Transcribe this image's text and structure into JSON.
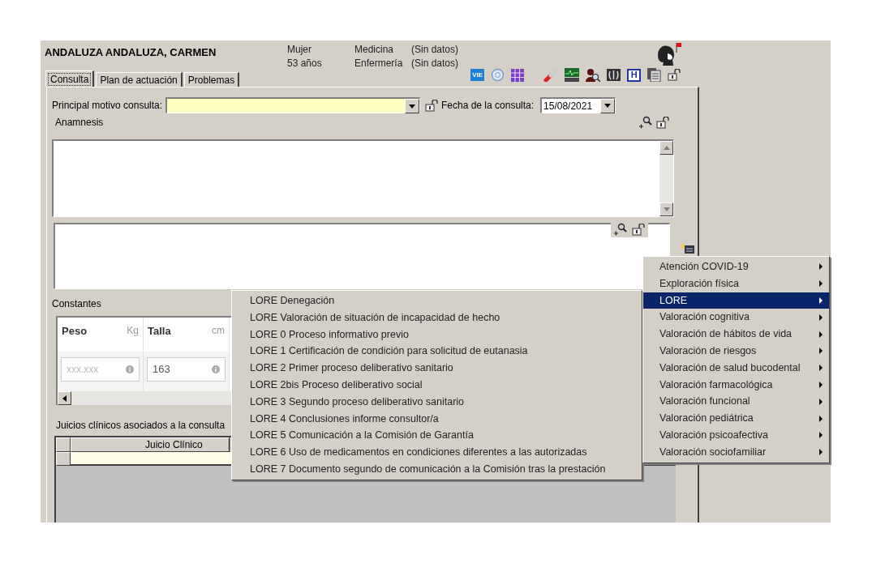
{
  "patient": {
    "name": "ANDALUZA ANDALUZA, CARMEN",
    "sex": "Mujer",
    "age": "53 años"
  },
  "services": [
    {
      "name": "Medicina",
      "value": "(Sin datos)"
    },
    {
      "name": "Enfermería",
      "value": "(Sin datos)"
    }
  ],
  "toolbar": [
    {
      "kind": "vie",
      "text": "VIE"
    },
    {
      "kind": "circle"
    },
    {
      "kind": "grid"
    },
    {
      "kind": "pill"
    },
    {
      "kind": "monitor"
    },
    {
      "kind": "person-search"
    },
    {
      "kind": "xray"
    },
    {
      "kind": "hospital",
      "text": "H"
    },
    {
      "kind": "documents"
    },
    {
      "kind": "lock"
    }
  ],
  "tabs": [
    {
      "label": "Consulta",
      "selected": true
    },
    {
      "label": "Plan de actuación",
      "selected": false
    },
    {
      "label": "Problemas",
      "selected": false
    }
  ],
  "motivo": {
    "label": "Principal motivo consulta:"
  },
  "fecha": {
    "label": "Fecha de la consulta:",
    "value": "15/08/2021"
  },
  "anamnesis": {
    "label": "Anamnesis"
  },
  "constantes": {
    "label": "Constantes",
    "items": [
      {
        "name": "Peso",
        "unit": "Kg",
        "placeholder": "xxx.xxx"
      },
      {
        "name": "Talla",
        "unit": "cm",
        "value": "163"
      }
    ]
  },
  "juicios": {
    "label": "Juicios clínicos asociados a la consulta",
    "column": "Juicio Clínico"
  },
  "context_menu": [
    {
      "label": "Atención COVID-19",
      "selected": false
    },
    {
      "label": "Exploración física",
      "selected": false
    },
    {
      "label": "LORE",
      "selected": true
    },
    {
      "label": "Valoración cognitiva",
      "selected": false
    },
    {
      "label": "Valoración de hábitos de vida",
      "selected": false
    },
    {
      "label": "Valoración de riesgos",
      "selected": false
    },
    {
      "label": "Valoración de salud bucodental",
      "selected": false
    },
    {
      "label": "Valoración farmacológica",
      "selected": false
    },
    {
      "label": "Valoración funcional",
      "selected": false
    },
    {
      "label": "Valoración pediátrica",
      "selected": false
    },
    {
      "label": "Valoración psicoafectiva",
      "selected": false
    },
    {
      "label": "Valoración sociofamiliar",
      "selected": false
    }
  ],
  "submenu": [
    "LORE Denegación",
    "LORE Valoración de situación de incapacidad de hecho",
    "LORE 0 Proceso informativo previo",
    "LORE 1 Certificación de condición para solicitud de eutanasia",
    "LORE 2 Primer proceso deliberativo sanitario",
    "LORE 2bis Proceso deliberativo social",
    "LORE 3 Segundo proceso deliberativo sanitario",
    "LORE 4 Conclusiones informe consultor/a",
    "LORE 5 Comunicación a la Comisión de Garantía",
    "LORE 6 Uso de medicamentos en condiciones diferentes a las autorizadas",
    "LORE 7 Documento segundo de comunicación a la Comisión tras la prestación"
  ]
}
